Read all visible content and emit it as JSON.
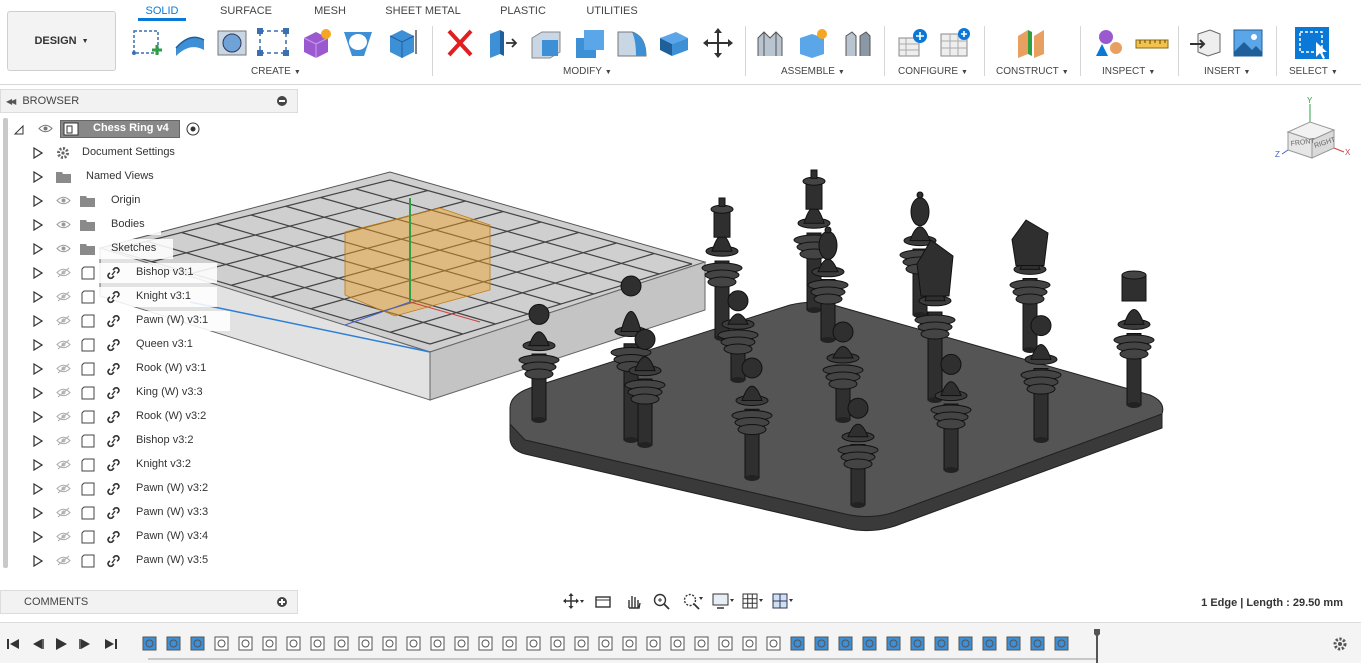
{
  "design_button": {
    "label": "DESIGN"
  },
  "workspace_tabs": [
    "SOLID",
    "SURFACE",
    "MESH",
    "SHEET METAL",
    "PLASTIC",
    "UTILITIES"
  ],
  "active_tab": "SOLID",
  "tool_groups": [
    "CREATE",
    "MODIFY",
    "ASSEMBLE",
    "CONFIGURE",
    "CONSTRUCT",
    "INSPECT",
    "INSERT",
    "SELECT"
  ],
  "browser": {
    "title": "BROWSER",
    "root": "Chess Ring v4",
    "items": [
      {
        "label": "Document Settings",
        "kind": "settings"
      },
      {
        "label": "Named Views",
        "kind": "folder"
      },
      {
        "label": "Origin",
        "kind": "folder"
      },
      {
        "label": "Bodies",
        "kind": "folder"
      },
      {
        "label": "Sketches",
        "kind": "folder"
      },
      {
        "label": "Bishop v3:1",
        "kind": "component"
      },
      {
        "label": "Knight v3:1",
        "kind": "component"
      },
      {
        "label": "Pawn (W) v3:1",
        "kind": "component"
      },
      {
        "label": "Queen v3:1",
        "kind": "component"
      },
      {
        "label": "Rook (W) v3:1",
        "kind": "component"
      },
      {
        "label": "King (W) v3:3",
        "kind": "component"
      },
      {
        "label": "Rook (W) v3:2",
        "kind": "component"
      },
      {
        "label": "Bishop v3:2",
        "kind": "component"
      },
      {
        "label": "Knight v3:2",
        "kind": "component"
      },
      {
        "label": "Pawn (W) v3:2",
        "kind": "component"
      },
      {
        "label": "Pawn (W) v3:3",
        "kind": "component"
      },
      {
        "label": "Pawn (W) v3:4",
        "kind": "component"
      },
      {
        "label": "Pawn (W) v3:5",
        "kind": "component"
      }
    ]
  },
  "comments": {
    "title": "COMMENTS"
  },
  "status": {
    "text": "1 Edge | Length : 29.50 mm"
  },
  "viewcube": {
    "front": "FRONT",
    "right": "RIGHT",
    "axes": [
      "Y",
      "X",
      "Z"
    ]
  },
  "colors": {
    "accent": "#0a78d7",
    "selection_orange": "#f0a020",
    "body_grey": "#3a3a3a"
  }
}
